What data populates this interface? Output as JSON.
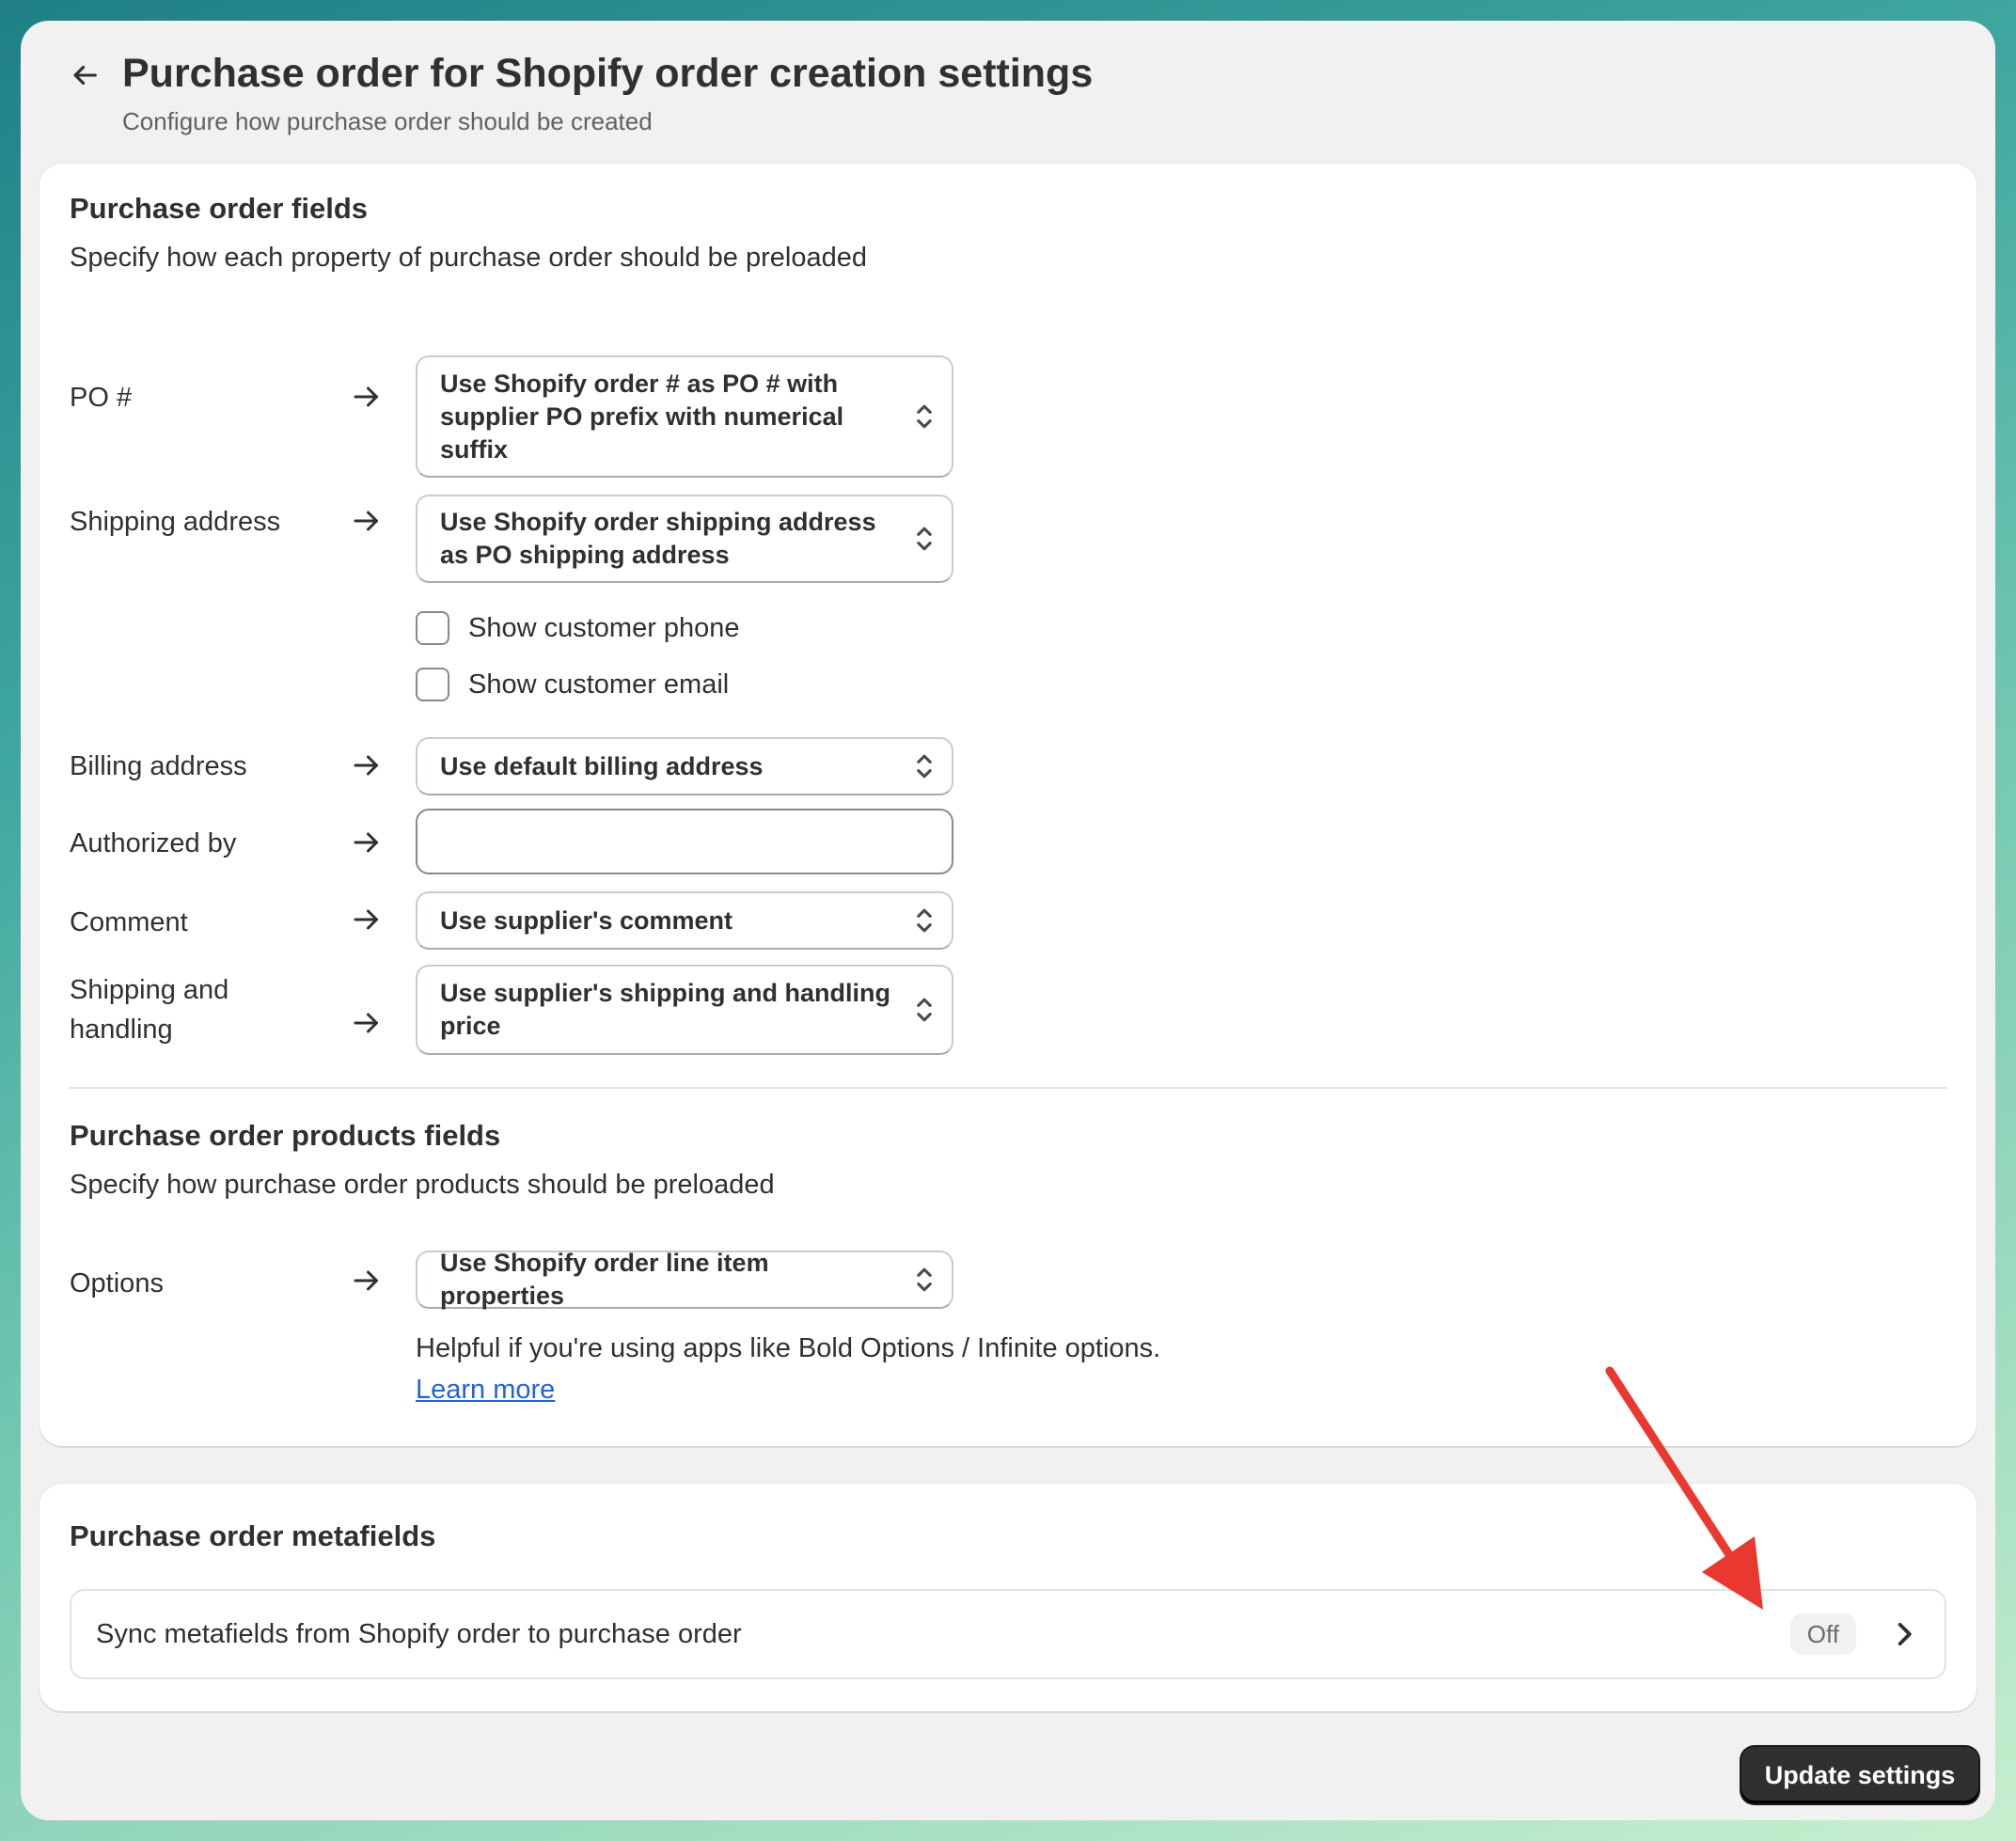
{
  "header": {
    "title": "Purchase order for Shopify order creation settings",
    "subtitle": "Configure how purchase order should be created"
  },
  "po_fields": {
    "title": "Purchase order fields",
    "description": "Specify how each property of purchase order should be preloaded",
    "po_number": {
      "label": "PO #",
      "value": "Use Shopify order # as PO # with supplier PO prefix with numerical suffix"
    },
    "shipping_address": {
      "label": "Shipping address",
      "value": "Use Shopify order shipping address as PO shipping address",
      "show_phone_label": "Show customer phone",
      "show_phone_checked": false,
      "show_email_label": "Show customer email",
      "show_email_checked": false
    },
    "billing_address": {
      "label": "Billing address",
      "value": "Use default billing address"
    },
    "authorized_by": {
      "label": "Authorized by",
      "value": ""
    },
    "comment": {
      "label": "Comment",
      "value": "Use supplier's comment"
    },
    "shipping_handling": {
      "label_line1": "Shipping and",
      "label_line2": "handling",
      "value": "Use supplier's shipping and handling price"
    }
  },
  "products_fields": {
    "title": "Purchase order products fields",
    "description": "Specify how purchase order products should be preloaded",
    "options": {
      "label": "Options",
      "value": "Use Shopify order line item properties",
      "help": "Helpful if you're using apps like Bold Options / Infinite options.",
      "learn_more": "Learn more"
    }
  },
  "metafields": {
    "title": "Purchase order metafields",
    "sync_label": "Sync metafields from Shopify order to purchase order",
    "sync_status": "Off"
  },
  "footer": {
    "update_button": "Update settings"
  },
  "colors": {
    "primary_button": "#303030",
    "link": "#2463d6",
    "annotation_arrow": "#e8382f",
    "background_gradient_start": "#1f7f86",
    "background_gradient_end": "#c7efcf"
  },
  "icons": {
    "back": "arrow-left-icon",
    "row_arrow": "arrow-right-icon",
    "select": "select-chevrons-icon",
    "row_chevron": "chevron-right-icon",
    "annotation": "red-annotation-arrow"
  }
}
